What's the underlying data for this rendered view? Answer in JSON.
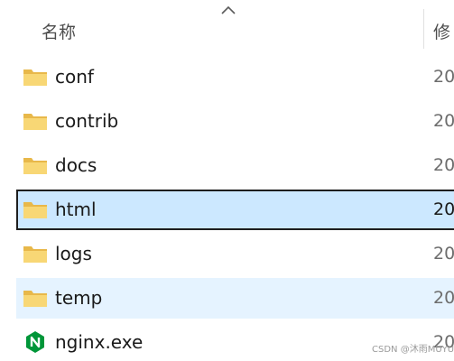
{
  "header": {
    "name_label": "名称",
    "modified_label": "修"
  },
  "items": [
    {
      "name": "conf",
      "type": "folder",
      "date": "20"
    },
    {
      "name": "contrib",
      "type": "folder",
      "date": "20"
    },
    {
      "name": "docs",
      "type": "folder",
      "date": "20"
    },
    {
      "name": "html",
      "type": "folder",
      "date": "20",
      "state": "selected"
    },
    {
      "name": "logs",
      "type": "folder",
      "date": "20"
    },
    {
      "name": "temp",
      "type": "folder",
      "date": "20",
      "state": "hover"
    },
    {
      "name": "nginx.exe",
      "type": "exe",
      "icon": "nginx-icon",
      "date": "20"
    }
  ],
  "watermark": "CSDN @沐雨MUYU",
  "colors": {
    "folder": "#f8d775",
    "selected_bg": "#cce8ff",
    "hover_bg": "#e5f3ff",
    "nginx_green": "#009639"
  }
}
